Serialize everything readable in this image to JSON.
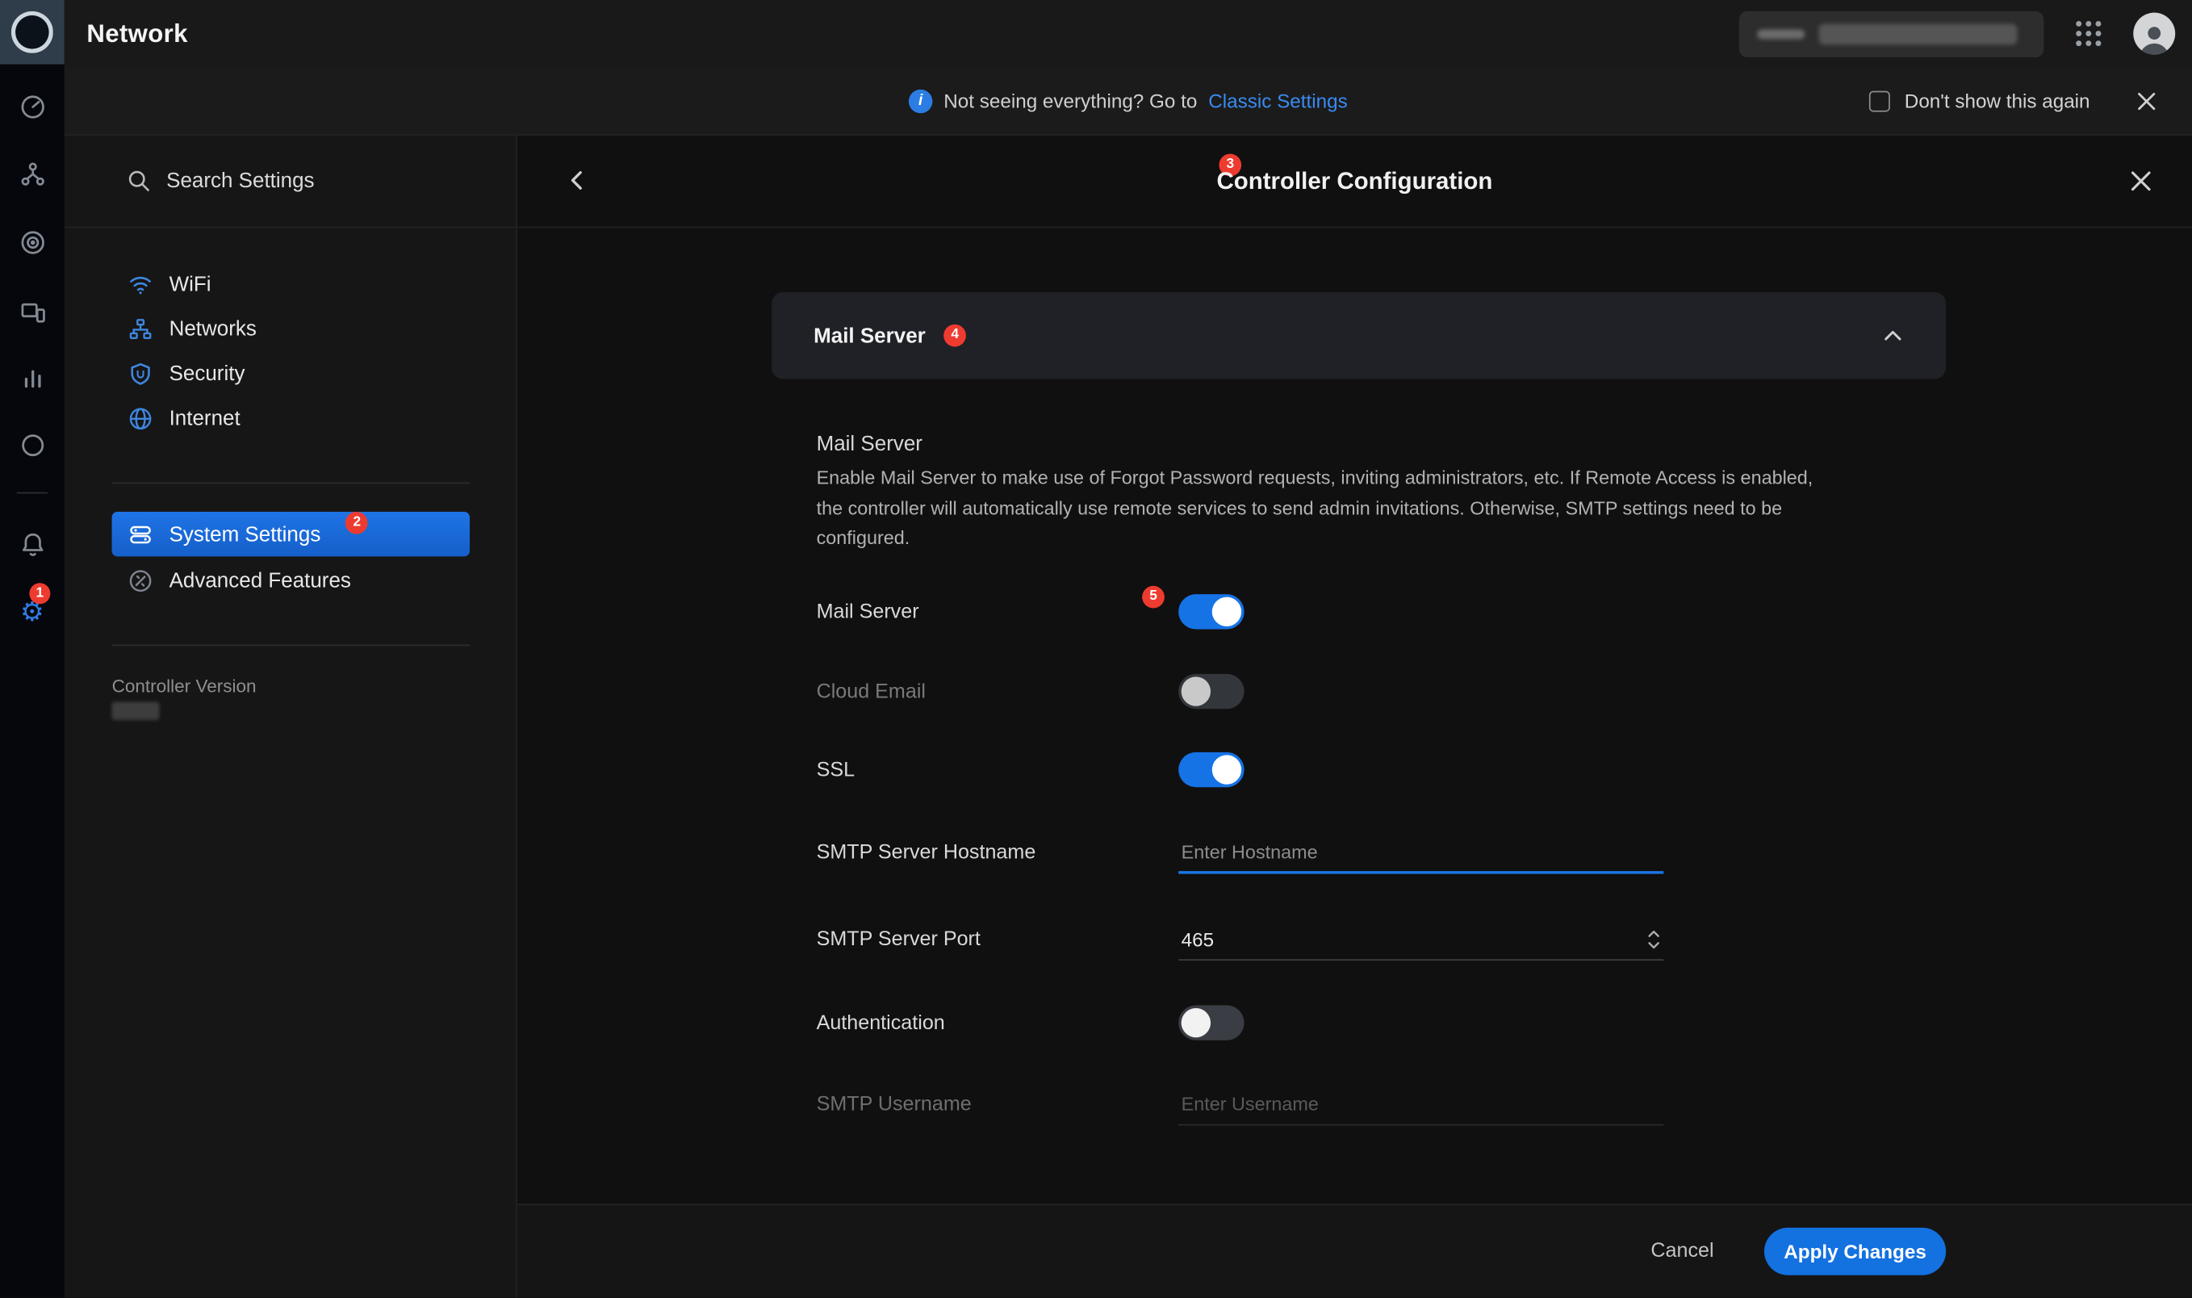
{
  "app": {
    "title": "Network"
  },
  "rail": {
    "settings_badge": "1",
    "icon_names": [
      "unifi-logo",
      "dashboard-icon",
      "topology-icon",
      "radios-icon",
      "devices-icon",
      "insights-icon",
      "clients-icon",
      "notifications-bell-icon",
      "settings-gear-icon"
    ]
  },
  "banner": {
    "info_glyph": "i",
    "info_text": "Not seeing everything? Go to",
    "link_label": "Classic Settings",
    "dismiss_label": "Don't show this again"
  },
  "sidebar": {
    "search_placeholder": "Search Settings",
    "nav_primary": [
      {
        "label": "WiFi",
        "icon": "wifi-icon"
      },
      {
        "label": "Networks",
        "icon": "networks-icon"
      },
      {
        "label": "Security",
        "icon": "security-shield-icon"
      },
      {
        "label": "Internet",
        "icon": "internet-globe-icon"
      }
    ],
    "nav_secondary": [
      {
        "label": "System Settings",
        "icon": "system-settings-icon",
        "badge": "2",
        "active": true
      },
      {
        "label": "Advanced Features",
        "icon": "advanced-features-icon",
        "active": false
      }
    ],
    "controller_version_label": "Controller Version"
  },
  "panel": {
    "title": "Controller Configuration",
    "title_badge": "3",
    "card_title": "Mail Server",
    "card_badge": "4",
    "section_title": "Mail Server",
    "section_description": "Enable Mail Server to make use of Forgot Password requests, inviting administrators, etc. If Remote Access is enabled, the controller will automatically use remote services to send admin invitations. Otherwise, SMTP settings need to be configured.",
    "fields": {
      "mail_server": {
        "label": "Mail Server",
        "badge": "5",
        "enabled": true
      },
      "cloud_email": {
        "label": "Cloud Email",
        "enabled": false
      },
      "ssl": {
        "label": "SSL",
        "enabled": true
      },
      "smtp_hostname": {
        "label": "SMTP Server Hostname",
        "placeholder": "Enter Hostname",
        "value": ""
      },
      "smtp_port": {
        "label": "SMTP Server Port",
        "value": "465"
      },
      "authentication": {
        "label": "Authentication",
        "enabled": false
      },
      "smtp_username": {
        "label": "SMTP Username",
        "placeholder": "Enter Username",
        "value": ""
      }
    },
    "footer": {
      "cancel": "Cancel",
      "apply": "Apply Changes"
    }
  },
  "colors": {
    "accent_blue": "#1673e6",
    "link_blue": "#3a8bf2",
    "badge_red": "#ee3b30"
  }
}
